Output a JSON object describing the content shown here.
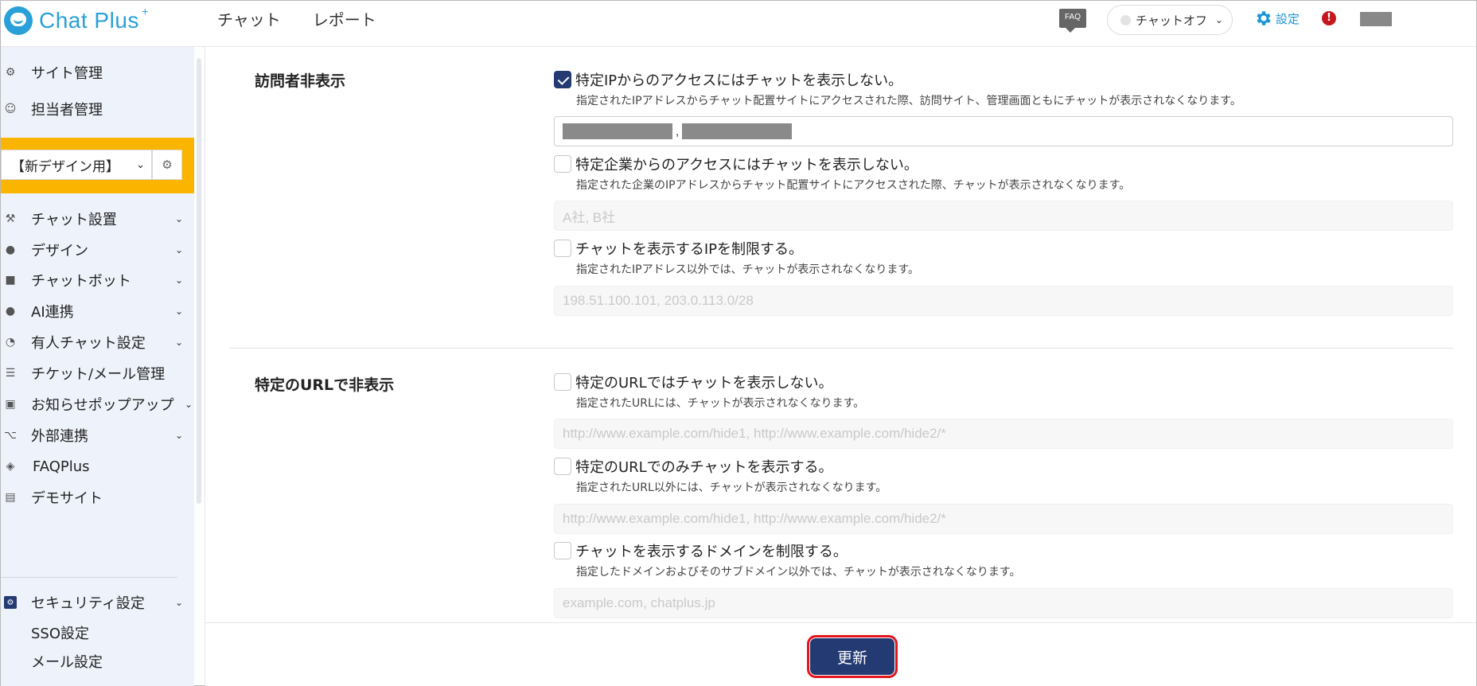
{
  "header": {
    "logo_text": "Chat Plus",
    "logo_sup": "+",
    "nav": [
      "チャット",
      "レポート"
    ],
    "faq_badge": "FAQ",
    "chat_status": "チャットオフ",
    "settings_label": "設定",
    "alert_mark": "!"
  },
  "sidebar": {
    "top_items": [
      "サイト管理",
      "担当者管理"
    ],
    "site_select_value": "【新デザイン用】",
    "menu": [
      "チャット設置",
      "デザイン",
      "チャットボット",
      "AI連携",
      "有人チャット設定",
      "チケット/メール管理",
      "お知らせポップアップ",
      "外部連携",
      "FAQPlus",
      "デモサイト"
    ],
    "security_label": "セキュリティ設定",
    "security_sub": [
      "SSO設定",
      "メール設定"
    ]
  },
  "sections": {
    "visitor_hide_title": "訪問者非表示",
    "url_hide_title": "特定のURLで非表示"
  },
  "options": {
    "ip_hide": {
      "label": "特定IPからのアクセスにはチャットを表示しない。",
      "desc": "指定されたIPアドレスからチャット配置サイトにアクセスされた際、訪問サイト、管理画面ともにチャットが表示されなくなります。",
      "checked": true
    },
    "company_hide": {
      "label": "特定企業からのアクセスにはチャットを表示しない。",
      "desc": "指定された企業のIPアドレスからチャット配置サイトにアクセスされた際、チャットが表示されなくなります。",
      "placeholder": "A社, B社",
      "checked": false
    },
    "ip_limit": {
      "label": "チャットを表示するIPを制限する。",
      "desc": "指定されたIPアドレス以外では、チャットが表示されなくなります。",
      "placeholder": "198.51.100.101, 203.0.113.0/28",
      "checked": false
    },
    "url_hide": {
      "label": "特定のURLではチャットを表示しない。",
      "desc": "指定されたURLには、チャットが表示されなくなります。",
      "placeholder": "http://www.example.com/hide1, http://www.example.com/hide2/*",
      "checked": false
    },
    "url_only": {
      "label": "特定のURLでのみチャットを表示する。",
      "desc": "指定されたURL以外には、チャットが表示されなくなります。",
      "placeholder": "http://www.example.com/hide1, http://www.example.com/hide2/*",
      "checked": false
    },
    "domain_limit": {
      "label": "チャットを表示するドメインを制限する。",
      "desc": "指定したドメインおよびそのサブドメイン以外では、チャットが表示されなくなります。",
      "placeholder": "example.com, chatplus.jp",
      "checked": false
    }
  },
  "ip_field_separator": ",",
  "footer": {
    "update_label": "更新"
  },
  "colors": {
    "brand": "#2aa0d8",
    "primary": "#243a73",
    "highlight": "#fbb400",
    "alert": "#c4181e",
    "focus_ring": "#e3141b"
  }
}
